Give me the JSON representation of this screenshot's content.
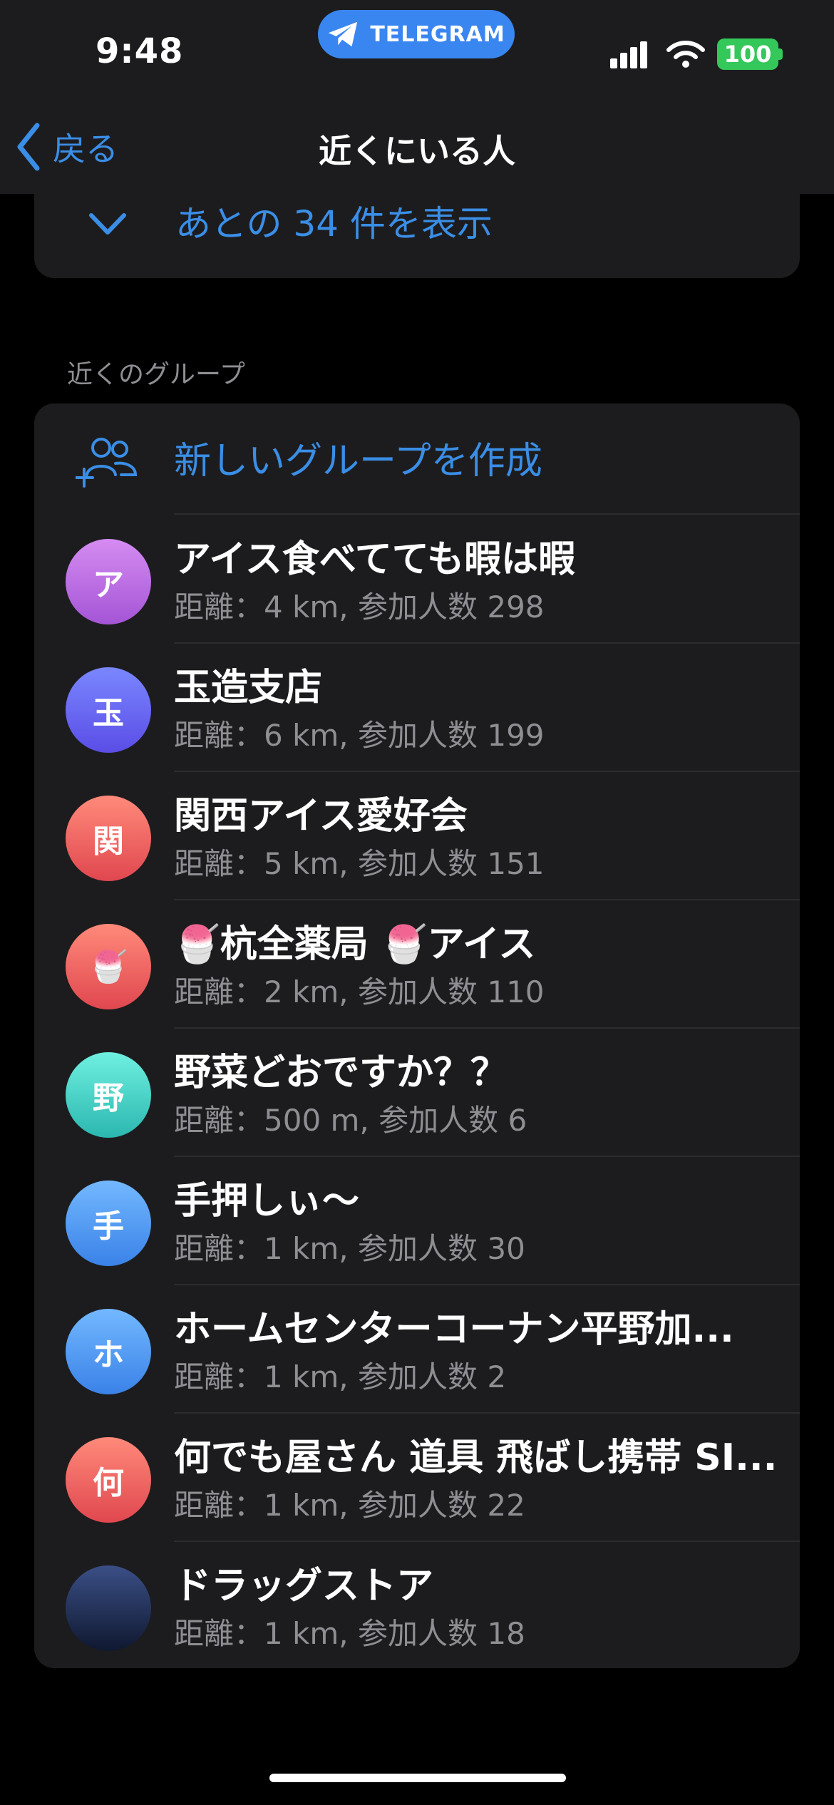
{
  "status": {
    "time": "9:48",
    "app_pill": "TELEGRAM",
    "battery": "100"
  },
  "nav": {
    "back_label": "戻る",
    "title": "近くにいる人"
  },
  "show_more": {
    "label": "あとの 34 件を表示"
  },
  "section": {
    "header": "近くのグループ"
  },
  "create_group": {
    "label": "新しいグループを作成"
  },
  "groups": [
    {
      "initial": "ア",
      "name": "アイス食べてても暇は暇",
      "meta": "距離：4 km, 参加人数 298",
      "color_top": "#d58cf1",
      "color_bottom": "#a455d6"
    },
    {
      "initial": "玉",
      "name": "玉造支店",
      "meta": "距離：6 km, 参加人数 199",
      "color_top": "#7a87ff",
      "color_bottom": "#5a4de6"
    },
    {
      "initial": "関",
      "name": "関西アイス愛好会",
      "meta": "距離：5 km, 参加人数 151",
      "color_top": "#ff8a7a",
      "color_bottom": "#e0474f"
    },
    {
      "initial": "🍧",
      "name": "🍧杭全薬局 🍧アイス",
      "meta": "距離：2 km, 参加人数 110",
      "color_top": "#ff8a7a",
      "color_bottom": "#e0474f"
    },
    {
      "initial": "野",
      "name": "野菜どおですか？？",
      "meta": "距離：500 m, 参加人数 6",
      "color_top": "#6ff0e0",
      "color_bottom": "#2bb7b0"
    },
    {
      "initial": "手",
      "name": "手押しぃ〜",
      "meta": "距離：1 km, 参加人数 30",
      "color_top": "#73b8ff",
      "color_bottom": "#3a82e8"
    },
    {
      "initial": "ホ",
      "name": "ホームセンターコーナン平野加...",
      "meta": "距離：1 km, 参加人数 2",
      "color_top": "#73b8ff",
      "color_bottom": "#3a82e8"
    },
    {
      "initial": "何",
      "name": "何でも屋さん 道具 飛ばし携帯 SI...",
      "meta": "距離：1 km, 参加人数 22",
      "color_top": "#ff8a7a",
      "color_bottom": "#e0474f"
    },
    {
      "initial": "",
      "name": "ドラッグストア",
      "meta": "距離：1 km, 参加人数 18",
      "color_top": "#3b4f86",
      "color_bottom": "#0f1830"
    }
  ]
}
